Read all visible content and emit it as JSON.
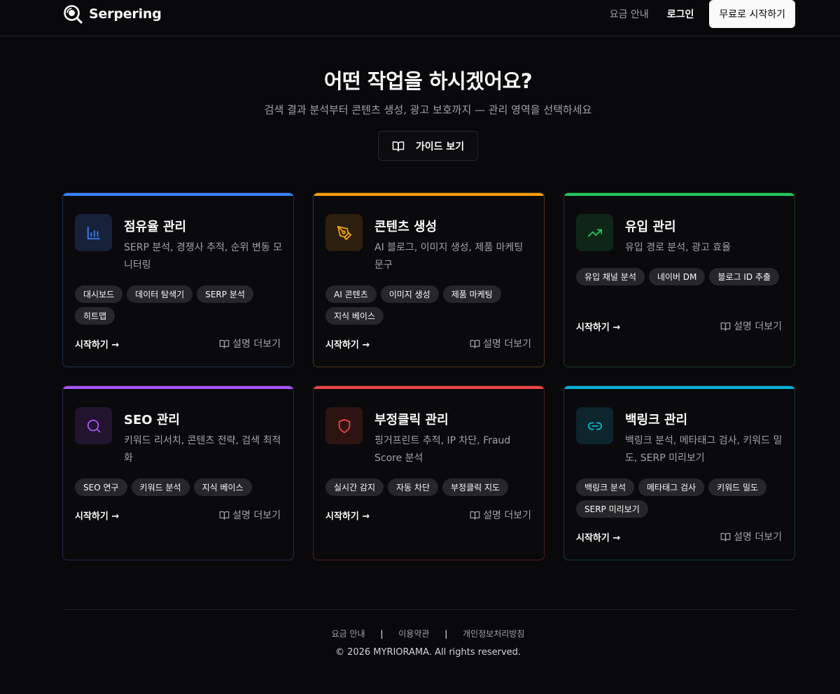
{
  "header": {
    "brand": "Serpering",
    "nav": {
      "pricing": "요금 안내",
      "login": "로그인",
      "cta": "무료로 시작하기"
    }
  },
  "hero": {
    "title": "어떤 작업을 하시겠어요?",
    "subtitle": "검색 결과 분석부터 콘텐츠 생성, 광고 보호까지 — 관리 영역을 선택하세요",
    "guide_button": "가이드 보기"
  },
  "cards": [
    {
      "title": "점유율 관리",
      "desc": "SERP 분석, 경쟁사 추적, 순위 변동 모니터링",
      "tags": [
        "대시보드",
        "데이터 탐색기",
        "SERP 분석",
        "히트맵"
      ],
      "start": "시작하기 →",
      "more": "설명 더보기",
      "icon": "bar-chart-icon",
      "accent": "#3b82f6"
    },
    {
      "title": "콘텐츠 생성",
      "desc": "AI 블로그, 이미지 생성, 제품 마케팅 문구",
      "tags": [
        "AI 콘텐츠",
        "이미지 생성",
        "제품 마케팅",
        "지식 베이스"
      ],
      "start": "시작하기 →",
      "more": "설명 더보기",
      "icon": "pen-tool-icon",
      "accent": "#f59e0b"
    },
    {
      "title": "유입 관리",
      "desc": "유입 경로 분석, 광고 효율",
      "tags": [
        "유입 채널 분석",
        "네이버 DM",
        "블로그 ID 추출"
      ],
      "start": "시작하기 →",
      "more": "설명 더보기",
      "icon": "trending-up-icon",
      "accent": "#22c55e"
    },
    {
      "title": "SEO 관리",
      "desc": "키워드 리서치, 콘텐츠 전략, 검색 최적화",
      "tags": [
        "SEO 연구",
        "키워드 분석",
        "지식 베이스"
      ],
      "start": "시작하기 →",
      "more": "설명 더보기",
      "icon": "search-icon",
      "accent": "#a855f7"
    },
    {
      "title": "부정클릭 관리",
      "desc": "핑거프린트 추적, IP 차단, Fraud Score 분석",
      "tags": [
        "실시간 감지",
        "자동 차단",
        "부정클릭 지도"
      ],
      "start": "시작하기 →",
      "more": "설명 더보기",
      "icon": "shield-icon",
      "accent": "#ef4444"
    },
    {
      "title": "백링크 관리",
      "desc": "백링크 분석, 메타태그 검사, 키워드 밀도, SERP 미리보기",
      "tags": [
        "백링크 분석",
        "메타태그 검사",
        "키워드 밀도",
        "SERP 미리보기"
      ],
      "start": "시작하기 →",
      "more": "설명 더보기",
      "icon": "link-icon",
      "accent": "#06b6d4"
    }
  ],
  "footer": {
    "links": [
      "요금 안내",
      "이용약관",
      "개인정보처리방침"
    ],
    "copyright": "© 2026 MYRIORAMA. All rights reserved."
  }
}
